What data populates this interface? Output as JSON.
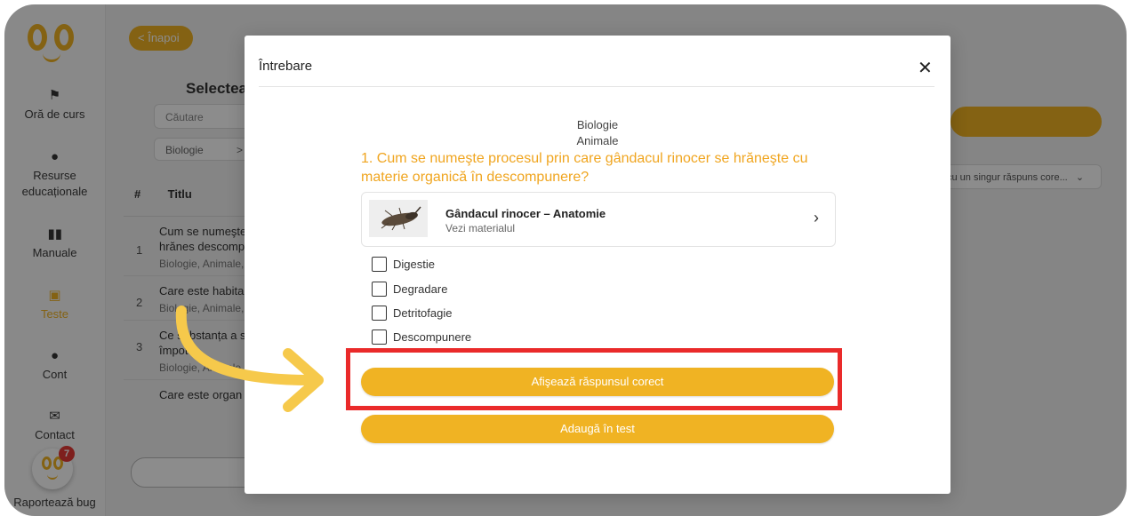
{
  "sidebar": {
    "items": [
      {
        "label": "Oră de curs",
        "icon": "teacher-board-icon"
      },
      {
        "label": "Resurse educaționale",
        "icon": "box-icon"
      },
      {
        "label": "Manuale",
        "icon": "book-icon"
      },
      {
        "label": "Teste",
        "icon": "document-icon",
        "active": true
      },
      {
        "label": "Cont",
        "icon": "user-icon"
      },
      {
        "label": "Contact",
        "icon": "envelope-icon"
      }
    ],
    "notification_count": "7",
    "report_bug": "Raportează bug"
  },
  "background": {
    "back_label": "< Înapoi",
    "heading": "Selecteaz",
    "search_placeholder": "Căutare",
    "filter_value": "Biologie",
    "filter_separator": ">",
    "table_headers": {
      "num": "#",
      "title": "Titlu"
    },
    "rows": [
      {
        "num": "1",
        "question": "Cum se numeşte rinocer se hrănes descompunere?",
        "tags": "Biologie, Animale,"
      },
      {
        "num": "2",
        "question": "Care este habita rinocer?",
        "tags": "Biologie, Animale,"
      },
      {
        "num": "3",
        "question": "Ce substanța a se apăra împot",
        "tags": "Biologie, Animale,"
      },
      {
        "num": "",
        "question": "Care este organ",
        "tags": ""
      }
    ],
    "type_select": "cu un singur răspuns core..."
  },
  "modal": {
    "title": "Întrebare",
    "breadcrumb_subject": "Biologie",
    "breadcrumb_topic": "Animale",
    "question": "1. Cum se numeşte procesul prin care gândacul rinocer se hrăneşte cu materie organică în descompunere?",
    "material": {
      "title": "Gândacul rinocer – Anatomie",
      "subtitle": "Vezi materialul"
    },
    "options": [
      "Digestie",
      "Degradare",
      "Detritofagie",
      "Descompunere"
    ],
    "show_answer_label": "Afişează răspunsul corect",
    "add_to_test_label": "Adaugă în test"
  },
  "colors": {
    "accent": "#f0b323",
    "highlight": "#ea2a2a",
    "arrow": "#f6c94b"
  }
}
